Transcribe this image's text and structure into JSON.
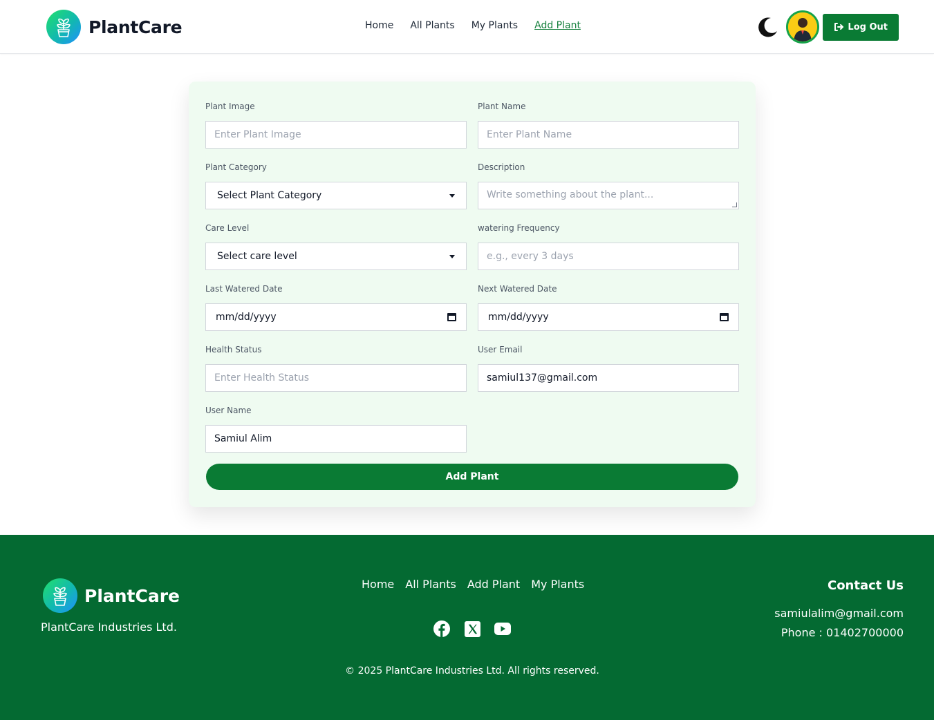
{
  "brand": {
    "name": "PlantCare"
  },
  "nav": {
    "links": [
      "Home",
      "All Plants",
      "My Plants",
      "Add Plant"
    ],
    "active": "Add Plant",
    "logout_label": "Log Out"
  },
  "form": {
    "plant_image": {
      "label": "Plant Image",
      "placeholder": "Enter Plant Image"
    },
    "plant_name": {
      "label": "Plant Name",
      "placeholder": "Enter Plant Name"
    },
    "plant_category": {
      "label": "Plant Category",
      "value": "Select Plant Category"
    },
    "description": {
      "label": "Description",
      "placeholder": "Write something about the plant..."
    },
    "care_level": {
      "label": "Care Level",
      "value": "Select care level"
    },
    "watering_frequency": {
      "label": "watering Frequency",
      "placeholder": "e.g., every 3 days"
    },
    "last_watered": {
      "label": "Last Watered Date",
      "value": "mm/dd/yyyy"
    },
    "next_watered": {
      "label": "Next Watered Date",
      "value": "mm/dd/yyyy"
    },
    "health_status": {
      "label": "Health Status",
      "placeholder": "Enter Health Status"
    },
    "user_email": {
      "label": "User Email",
      "value": "samiul137@gmail.com"
    },
    "user_name": {
      "label": "User Name",
      "value": "Samiul Alim"
    },
    "submit_label": "Add Plant"
  },
  "footer": {
    "brand_name": "PlantCare",
    "company": "PlantCare Industries Ltd.",
    "links": [
      "Home",
      "All Plants",
      "Add Plant",
      "My Plants"
    ],
    "social": [
      "facebook-icon",
      "x-twitter-icon",
      "youtube-icon"
    ],
    "copyright": "© 2025 PlantCare Industries Ltd. All rights reserved.",
    "contact_title": "Contact Us",
    "contact_email": "samiulalim@gmail.com",
    "contact_phone": "Phone : 01402700000"
  },
  "colors": {
    "primary": "#0a7b34",
    "footer_bg": "#046a32",
    "card_bg": "#effbf1",
    "active_link": "#15803d",
    "avatar_bg": "#facc15"
  }
}
